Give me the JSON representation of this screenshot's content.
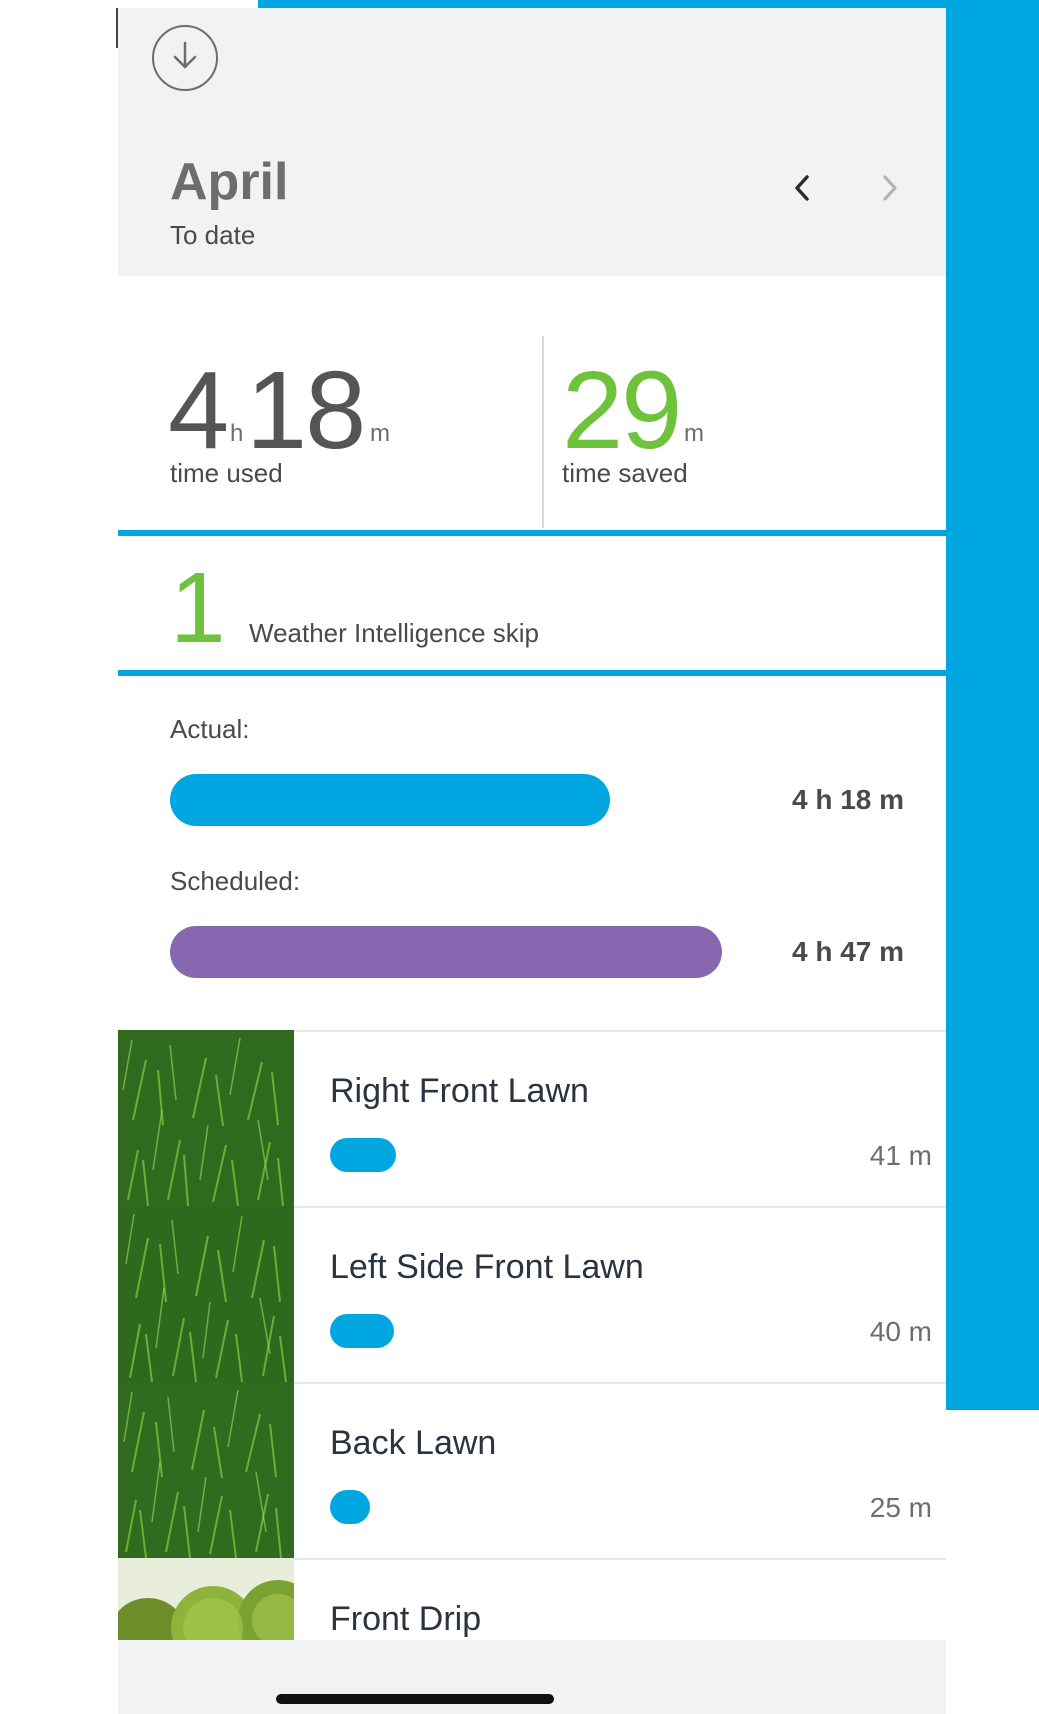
{
  "header": {
    "month": "April",
    "subtitle": "To date"
  },
  "stats": {
    "time_used": {
      "hours": "4",
      "hours_unit": "h",
      "minutes": "18",
      "minutes_unit": "m",
      "label": "time used"
    },
    "time_saved": {
      "minutes": "29",
      "minutes_unit": "m",
      "label": "time saved"
    }
  },
  "weather_skip": {
    "count": "1",
    "label": "Weather Intelligence skip"
  },
  "comparison": {
    "actual": {
      "label": "Actual:",
      "value": "4 h 18 m",
      "minutes": 258,
      "color": "#00a6e0"
    },
    "scheduled": {
      "label": "Scheduled:",
      "value": "4 h 47 m",
      "minutes": 287,
      "color": "#8767b0"
    }
  },
  "zones": [
    {
      "name": "Right Front Lawn",
      "time": "41 m",
      "minutes": 41
    },
    {
      "name": "Left Side Front Lawn",
      "time": "40 m",
      "minutes": 40
    },
    {
      "name": "Back Lawn",
      "time": "25 m",
      "minutes": 25
    },
    {
      "name": "Front Drip",
      "time": "",
      "minutes": 0
    }
  ],
  "colors": {
    "accent": "#00a6e0",
    "saved_green": "#6fc23c",
    "scheduled_purple": "#8767b0",
    "header_bg": "#f1f2f3"
  },
  "icons": {
    "download": "download-circle-icon",
    "prev": "chevron-left-icon",
    "next": "chevron-right-icon"
  }
}
